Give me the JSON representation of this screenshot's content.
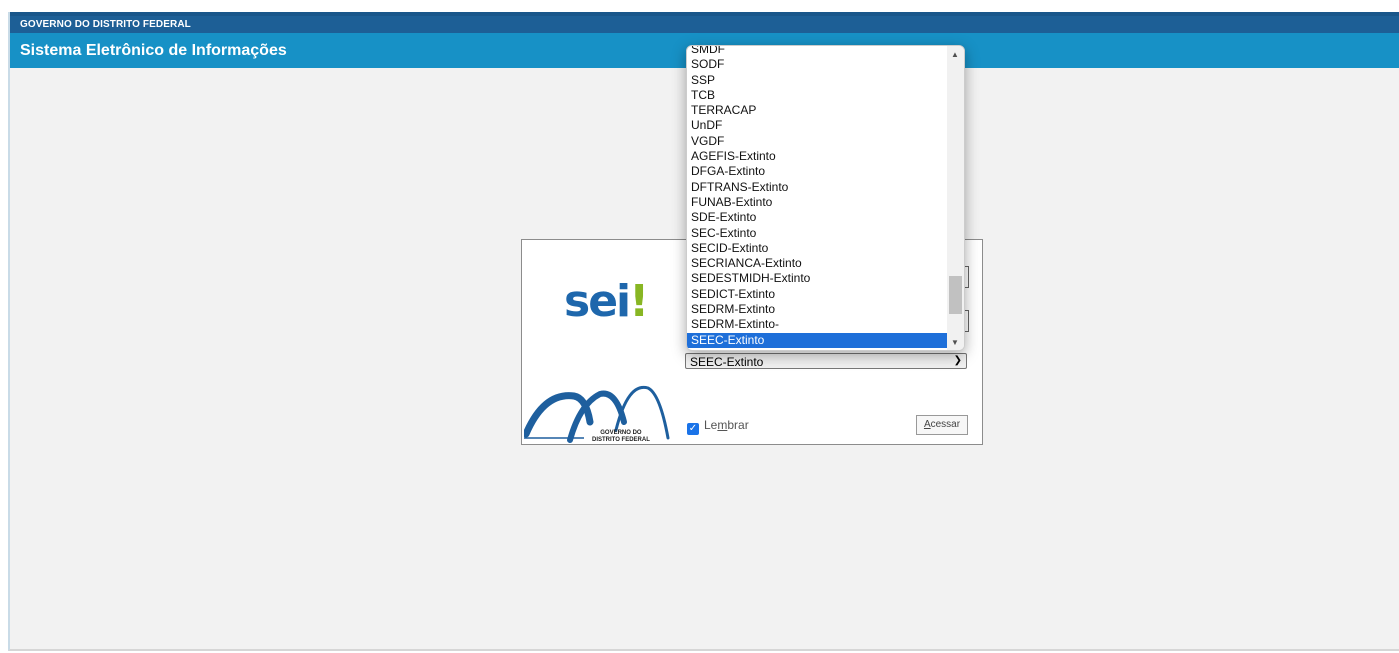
{
  "header": {
    "gov_label": "GOVERNO DO DISTRITO FEDERAL",
    "system_title": "Sistema Eletrônico de Informações"
  },
  "login": {
    "logo_text": "sei",
    "logo_bang": "!",
    "gdf_logo_line1": "GOVERNO DO",
    "gdf_logo_line2": "DISTRITO FEDERAL",
    "org_select_value": "SEEC-Extinto",
    "remember_label_pre": "Le",
    "remember_label_accent": "m",
    "remember_label_post": "brar",
    "remember_checked": true,
    "access_button_pre": "",
    "access_button_accent": "A",
    "access_button_post": "cessar"
  },
  "dropdown": {
    "options": [
      "SMDF",
      "SODF",
      "SSP",
      "TCB",
      "TERRACAP",
      "UnDF",
      "VGDF",
      "AGEFIS-Extinto",
      "DFGA-Extinto",
      "DFTRANS-Extinto",
      "FUNAB-Extinto",
      "SDE-Extinto",
      "SEC-Extinto",
      "SECID-Extinto",
      "SECRIANCA-Extinto",
      "SEDESTMIDH-Extinto",
      "SEDICT-Extinto",
      "SEDRM-Extinto",
      "SEDRM-Extinto-",
      "SEEC-Extinto"
    ],
    "selected": "SEEC-Extinto"
  },
  "colors": {
    "gov_bar": "#1d5f96",
    "title_bar": "#1791c6",
    "selected_option": "#1e6fd9",
    "logo_blue": "#1e67ac",
    "logo_green": "#88b623"
  }
}
